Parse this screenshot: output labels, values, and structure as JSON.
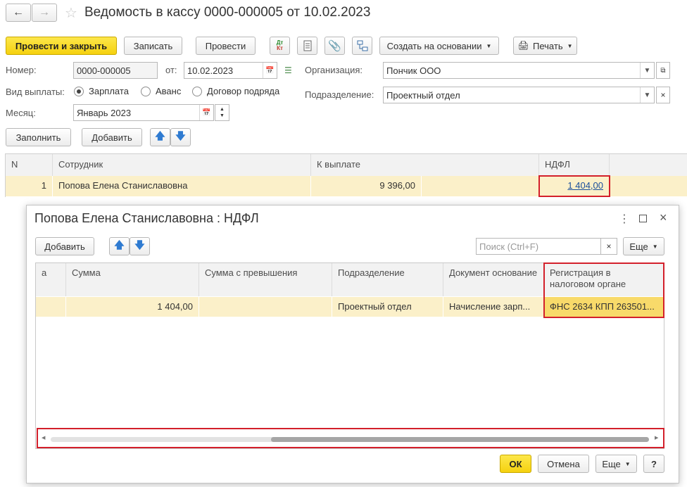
{
  "header": {
    "title": "Ведомость в кассу 0000-000005 от 10.02.2023",
    "back_icon": "arrow-left-icon",
    "forward_icon": "arrow-right-icon",
    "favorite_icon": "star-icon"
  },
  "toolbar": {
    "post_close_label": "Провести и закрыть",
    "save_label": "Записать",
    "post_label": "Провести",
    "dtkt_top": "Дт",
    "dtkt_bottom": "Кт",
    "create_based_label": "Создать на основании",
    "print_label": "Печать"
  },
  "form": {
    "number_label": "Номер:",
    "number_value": "0000-000005",
    "date_label": "от:",
    "date_value": "10.02.2023",
    "org_label": "Организация:",
    "org_value": "Пончик ООО",
    "payment_type_label": "Вид выплаты:",
    "payment_types": [
      "Зарплата",
      "Аванс",
      "Договор подряда"
    ],
    "payment_selected": "Зарплата",
    "dept_label": "Подразделение:",
    "dept_value": "Проектный отдел",
    "month_label": "Месяц:",
    "month_value": "Январь 2023"
  },
  "table_toolbar": {
    "fill_label": "Заполнить",
    "add_label": "Добавить"
  },
  "main_table": {
    "columns": [
      "N",
      "Сотрудник",
      "К выплате",
      "НДФЛ"
    ],
    "rows": [
      {
        "n": "1",
        "employee": "Попова Елена Станиславовна",
        "to_pay": "9 396,00",
        "ndfl": "1 404,00"
      }
    ]
  },
  "dialog": {
    "title": "Попова Елена Станиславовна : НДФЛ",
    "add_label": "Добавить",
    "search_placeholder": "Поиск (Ctrl+F)",
    "more_label": "Еще",
    "columns": [
      "а",
      "Сумма",
      "Сумма с превышения",
      "Подразделение",
      "Документ основание",
      "Регистрация в налоговом органе"
    ],
    "rows": [
      {
        "a": "",
        "sum": "1 404,00",
        "sum_excess": "",
        "dept": "Проектный отдел",
        "doc": "Начисление зарп...",
        "reg": "ФНС 2634 КПП 263501..."
      }
    ],
    "ok_label": "ОК",
    "cancel_label": "Отмена",
    "more_footer_label": "Еще",
    "help_label": "?"
  },
  "colors": {
    "accent_yellow": "#f5d10f",
    "highlight_red": "#d3202b",
    "row_highlight": "#fbf0c9",
    "link_blue": "#1a4f9c"
  }
}
